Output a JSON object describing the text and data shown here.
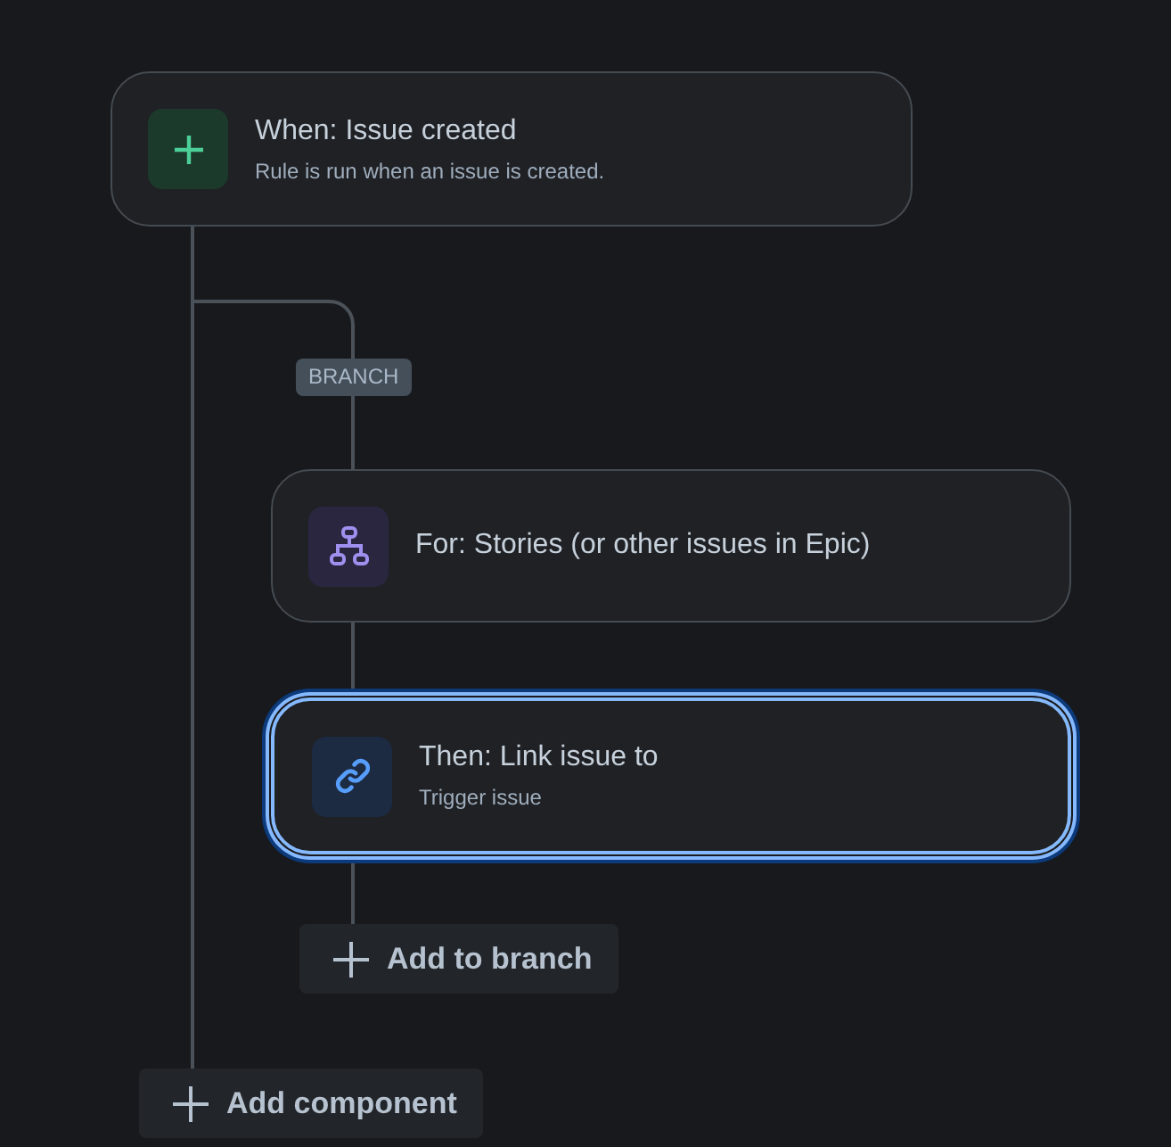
{
  "trigger": {
    "kind": "trigger",
    "title": "When: Issue created",
    "description": "Rule is run when an issue is created.",
    "selected": false
  },
  "branch": {
    "badge": "BRANCH",
    "nodes": [
      {
        "kind": "branch",
        "title": "For: Stories (or other issues in Epic)",
        "selected": false
      },
      {
        "kind": "action",
        "title": "Then: Link issue to",
        "description": "Trigger issue",
        "selected": true
      }
    ],
    "add_button": {
      "label": "Add to branch"
    }
  },
  "add_component_button": {
    "label": "Add component"
  }
}
